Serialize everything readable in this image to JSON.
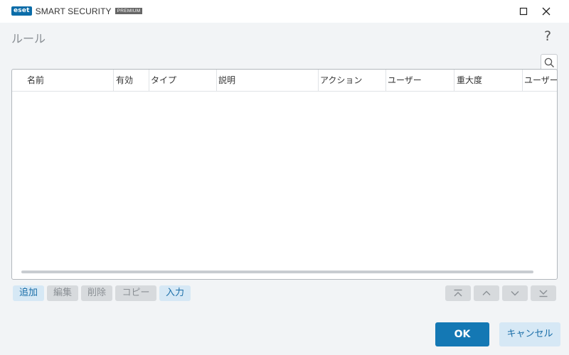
{
  "titlebar": {
    "brand": "eset",
    "product": "SMART SECURITY",
    "edition": "PREMIUM"
  },
  "dialog": {
    "title": "ルール",
    "help": "?"
  },
  "table": {
    "columns": [
      "名前",
      "有効",
      "タイプ",
      "説明",
      "アクション",
      "ユーザー",
      "重大度",
      "ユーザー"
    ],
    "rows": []
  },
  "toolbar": {
    "add": "追加",
    "edit": "編集",
    "delete": "削除",
    "copy": "コピー",
    "import": "入力"
  },
  "footer": {
    "ok": "OK",
    "cancel": "キャンセル"
  },
  "colors": {
    "accent": "#1478b4",
    "accent_light": "#d6e8f5",
    "disabled": "#d7dadd"
  }
}
